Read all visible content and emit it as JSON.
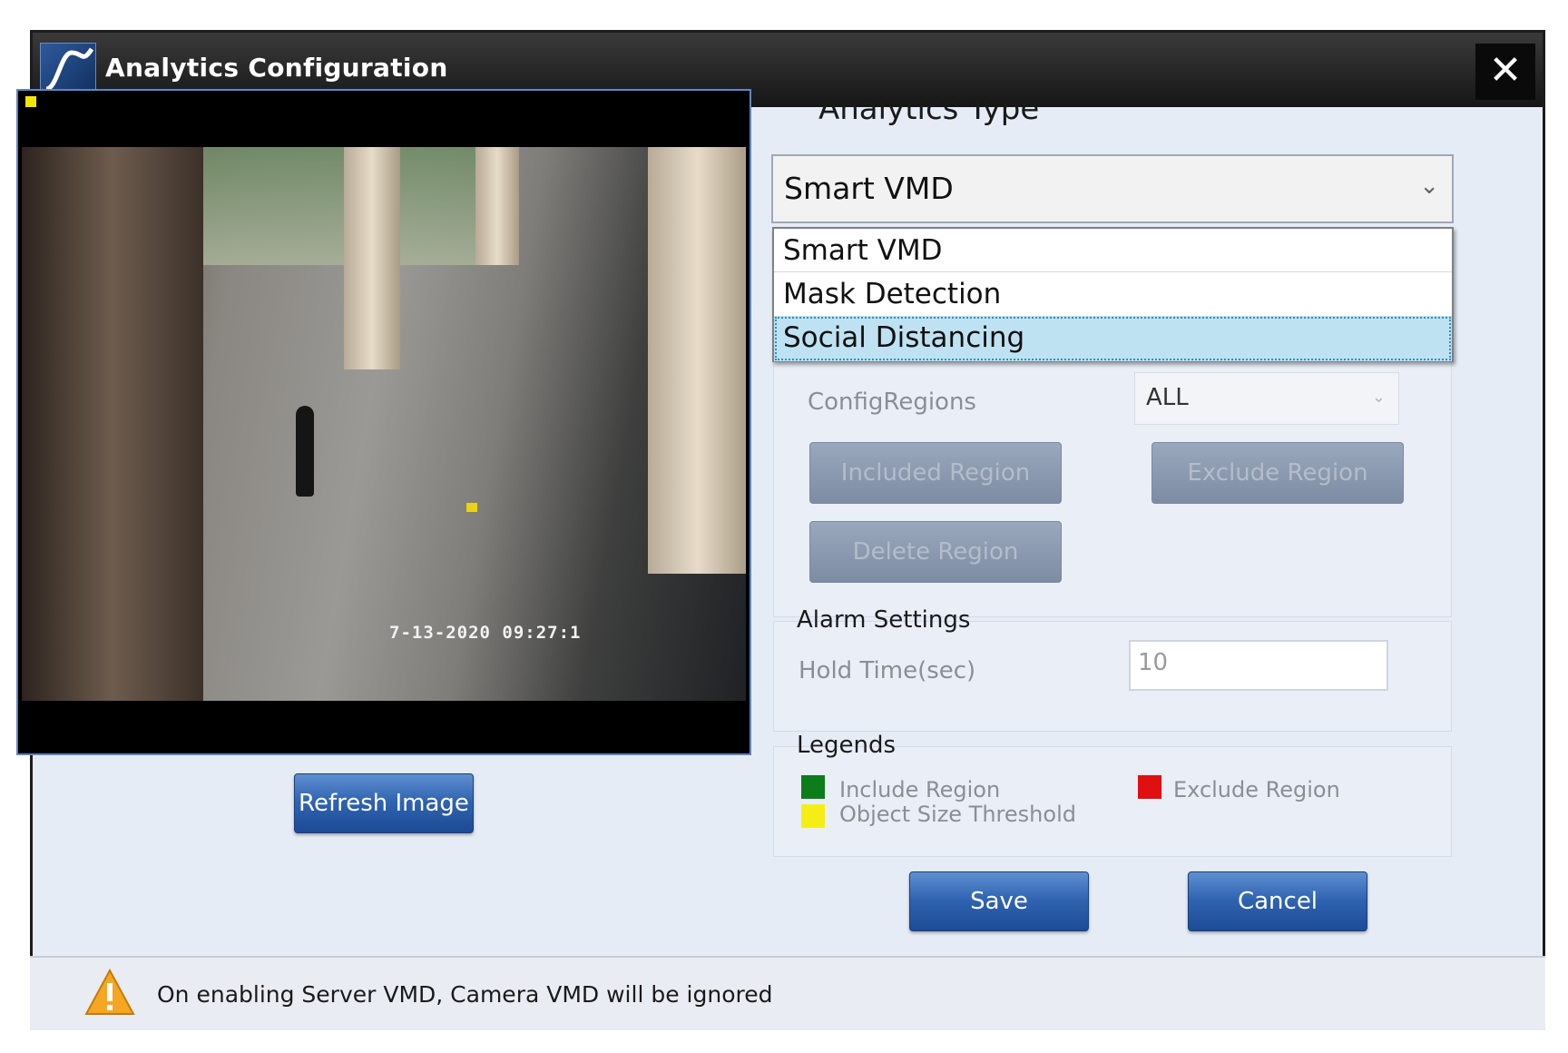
{
  "window": {
    "title": "Analytics Configuration",
    "close_icon": "close-icon",
    "logo_icon": "app-logo-icon"
  },
  "video": {
    "timestamp": "7-13-2020 09:27:1"
  },
  "buttons": {
    "refresh": "Refresh Image",
    "save": "Save",
    "cancel": "Cancel"
  },
  "analytics": {
    "label": "Analytics Type",
    "selected": "Smart VMD",
    "options": [
      "Smart VMD",
      "Mask Detection",
      "Social Distancing"
    ],
    "highlighted_option": "Social Distancing"
  },
  "regions": {
    "config_label": "ConfigRegions",
    "config_value": "ALL",
    "included_button": "Included Region",
    "exclude_button": "Exclude Region",
    "delete_button": "Delete Region"
  },
  "alarm": {
    "title": "Alarm Settings",
    "hold_label": "Hold Time(sec)",
    "hold_value": "10"
  },
  "legends": {
    "title": "Legends",
    "items": [
      {
        "label": "Include Region",
        "color": "#0c7d1a"
      },
      {
        "label": "Object Size Threshold",
        "color": "#f5ee16"
      },
      {
        "label": "Exclude Region",
        "color": "#e01010"
      }
    ]
  },
  "status": {
    "message": "On enabling Server VMD, Camera VMD will be ignored",
    "icon": "warning-icon"
  },
  "colors": {
    "titlebar": "#161616",
    "accent": "#2f63b0",
    "dialog_bg": "#e6ecf6",
    "selection": "#bfe2f2"
  }
}
